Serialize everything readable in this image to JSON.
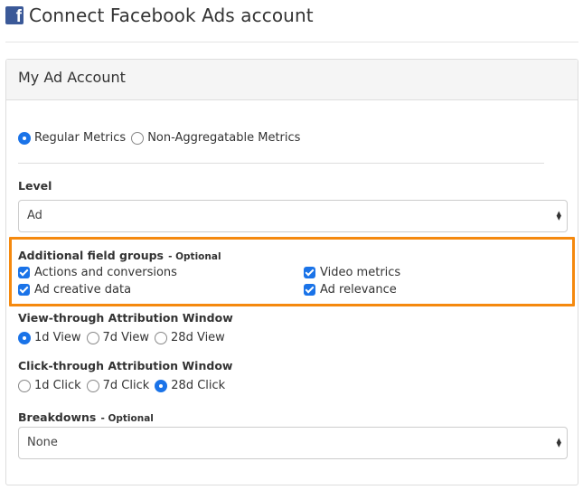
{
  "header": {
    "icon": "facebook-icon",
    "title": "Connect Facebook Ads account"
  },
  "panel": {
    "title": "My Ad Account",
    "metric_type": {
      "options": [
        "Regular Metrics",
        "Non-Aggregatable Metrics"
      ],
      "selected": "Regular Metrics"
    },
    "level": {
      "label": "Level",
      "value": "Ad"
    },
    "field_groups": {
      "label": "Additional field groups",
      "optional": "- Optional",
      "items": [
        {
          "label": "Actions and conversions",
          "checked": true
        },
        {
          "label": "Video metrics",
          "checked": true
        },
        {
          "label": "Ad creative data",
          "checked": true
        },
        {
          "label": "Ad relevance",
          "checked": true
        }
      ]
    },
    "view_through": {
      "label": "View-through Attribution Window",
      "options": [
        "1d View",
        "7d View",
        "28d View"
      ],
      "selected": "1d View"
    },
    "click_through": {
      "label": "Click-through Attribution Window",
      "options": [
        "1d Click",
        "7d Click",
        "28d Click"
      ],
      "selected": "28d Click"
    },
    "breakdowns": {
      "label": "Breakdowns",
      "optional": "- Optional",
      "value": "None"
    }
  },
  "colors": {
    "accent": "#1a73e8",
    "highlight": "#f5890e",
    "facebook": "#3b5998"
  }
}
